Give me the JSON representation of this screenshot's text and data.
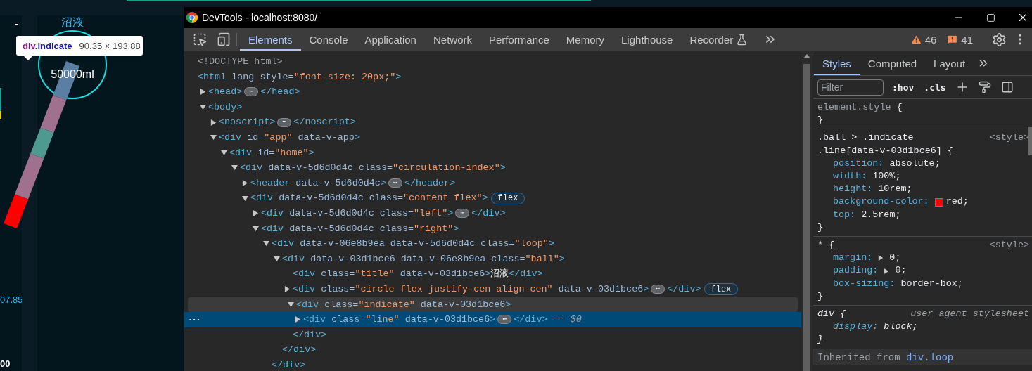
{
  "page": {
    "dash": "-",
    "axis_labels": [
      {
        "kind": "value",
        "text": "07.85"
      },
      {
        "kind": "total",
        "text": "00"
      }
    ],
    "ball": {
      "title": "沼液",
      "value": "50000ml"
    },
    "inspect_tooltip": {
      "tag": "div",
      "class_name": ".indicate",
      "size": "90.35 × 193.88"
    }
  },
  "devtools": {
    "window": {
      "title": "DevTools - localhost:8080/"
    },
    "tabs": [
      {
        "label": "Elements",
        "selected": true,
        "experimental": false
      },
      {
        "label": "Console",
        "selected": false,
        "experimental": false
      },
      {
        "label": "Application",
        "selected": false,
        "experimental": false
      },
      {
        "label": "Network",
        "selected": false,
        "experimental": false
      },
      {
        "label": "Performance",
        "selected": false,
        "experimental": false
      },
      {
        "label": "Memory",
        "selected": false,
        "experimental": false
      },
      {
        "label": "Lighthouse",
        "selected": false,
        "experimental": false
      },
      {
        "label": "Recorder",
        "selected": false,
        "experimental": true
      }
    ],
    "counters": {
      "warnings": "46",
      "issues": "41"
    },
    "tree": {
      "row_menu": "•••",
      "nodes": [
        {
          "selected": false,
          "hovered": false,
          "parts": [
            {
              "kind": "doctype",
              "text": "<!DOCTYPE html>"
            }
          ]
        },
        {
          "selected": false,
          "hovered": false,
          "parts": [
            {
              "kind": "tag",
              "text": "<html"
            },
            {
              "kind": "attr",
              "text": " lang style="
            },
            {
              "kind": "value",
              "text": "\"font-size: 20px;\""
            },
            {
              "kind": "tag",
              "text": ">"
            }
          ],
          "children": [
            {
              "selected": false,
              "hovered": false,
              "expanded": false,
              "parts": [
                {
                  "kind": "tag",
                  "text": "<head>"
                },
                {
                  "kind": "ellipsis",
                  "text": "⋯"
                },
                {
                  "kind": "tag",
                  "text": "</head>"
                }
              ]
            },
            {
              "selected": false,
              "hovered": false,
              "expanded": true,
              "parts": [
                {
                  "kind": "tag",
                  "text": "<body>"
                }
              ],
              "children": [
                {
                  "selected": false,
                  "hovered": false,
                  "expanded": false,
                  "parts": [
                    {
                      "kind": "tag",
                      "text": "<noscript>"
                    },
                    {
                      "kind": "ellipsis",
                      "text": "⋯"
                    },
                    {
                      "kind": "tag",
                      "text": "</noscript>"
                    }
                  ]
                },
                {
                  "selected": false,
                  "hovered": false,
                  "expanded": true,
                  "parts": [
                    {
                      "kind": "tag",
                      "text": "<div"
                    },
                    {
                      "kind": "attr",
                      "text": " id="
                    },
                    {
                      "kind": "value",
                      "text": "\"app\""
                    },
                    {
                      "kind": "attr",
                      "text": " data-v-app"
                    },
                    {
                      "kind": "tag",
                      "text": ">"
                    }
                  ],
                  "children": [
                    {
                      "selected": false,
                      "hovered": false,
                      "expanded": true,
                      "parts": [
                        {
                          "kind": "tag",
                          "text": "<div"
                        },
                        {
                          "kind": "attr",
                          "text": " id="
                        },
                        {
                          "kind": "value",
                          "text": "\"home\""
                        },
                        {
                          "kind": "tag",
                          "text": ">"
                        }
                      ],
                      "children": [
                        {
                          "selected": false,
                          "hovered": false,
                          "expanded": true,
                          "parts": [
                            {
                              "kind": "tag",
                              "text": "<div"
                            },
                            {
                              "kind": "attr",
                              "text": " data-v-5d6d0d4c class="
                            },
                            {
                              "kind": "value",
                              "text": "\"circulation-index\""
                            },
                            {
                              "kind": "tag",
                              "text": ">"
                            }
                          ],
                          "children": [
                            {
                              "selected": false,
                              "hovered": false,
                              "expanded": false,
                              "parts": [
                                {
                                  "kind": "tag",
                                  "text": "<header"
                                },
                                {
                                  "kind": "attr",
                                  "text": " data-v-5d6d0d4c"
                                },
                                {
                                  "kind": "tag",
                                  "text": ">"
                                },
                                {
                                  "kind": "ellipsis",
                                  "text": "⋯"
                                },
                                {
                                  "kind": "tag",
                                  "text": "</header>"
                                }
                              ]
                            },
                            {
                              "selected": false,
                              "hovered": false,
                              "expanded": true,
                              "parts": [
                                {
                                  "kind": "tag",
                                  "text": "<div"
                                },
                                {
                                  "kind": "attr",
                                  "text": " data-v-5d6d0d4c class="
                                },
                                {
                                  "kind": "value",
                                  "text": "\"content flex\""
                                },
                                {
                                  "kind": "tag",
                                  "text": ">"
                                },
                                {
                                  "kind": "badge",
                                  "text": "flex"
                                }
                              ],
                              "children": [
                                {
                                  "selected": false,
                                  "hovered": false,
                                  "expanded": false,
                                  "parts": [
                                    {
                                      "kind": "tag",
                                      "text": "<div"
                                    },
                                    {
                                      "kind": "attr",
                                      "text": " data-v-5d6d0d4c class="
                                    },
                                    {
                                      "kind": "value",
                                      "text": "\"left\""
                                    },
                                    {
                                      "kind": "tag",
                                      "text": ">"
                                    },
                                    {
                                      "kind": "ellipsis",
                                      "text": "⋯"
                                    },
                                    {
                                      "kind": "tag",
                                      "text": "</div>"
                                    }
                                  ]
                                },
                                {
                                  "selected": false,
                                  "hovered": false,
                                  "expanded": true,
                                  "parts": [
                                    {
                                      "kind": "tag",
                                      "text": "<div"
                                    },
                                    {
                                      "kind": "attr",
                                      "text": " data-v-5d6d0d4c class="
                                    },
                                    {
                                      "kind": "value",
                                      "text": "\"right\""
                                    },
                                    {
                                      "kind": "tag",
                                      "text": ">"
                                    }
                                  ],
                                  "children": [
                                    {
                                      "selected": false,
                                      "hovered": false,
                                      "expanded": true,
                                      "parts": [
                                        {
                                          "kind": "tag",
                                          "text": "<div"
                                        },
                                        {
                                          "kind": "attr",
                                          "text": " data-v-06e8b9ea data-v-5d6d0d4c class="
                                        },
                                        {
                                          "kind": "value",
                                          "text": "\"loop\""
                                        },
                                        {
                                          "kind": "tag",
                                          "text": ">"
                                        }
                                      ],
                                      "close": "</div>",
                                      "children": [
                                        {
                                          "selected": false,
                                          "hovered": false,
                                          "expanded": true,
                                          "parts": [
                                            {
                                              "kind": "tag",
                                              "text": "<div"
                                            },
                                            {
                                              "kind": "attr",
                                              "text": " data-v-03d1bce6 data-v-06e8b9ea class="
                                            },
                                            {
                                              "kind": "value",
                                              "text": "\"ball\""
                                            },
                                            {
                                              "kind": "tag",
                                              "text": ">"
                                            }
                                          ],
                                          "close": "</div>",
                                          "children": [
                                            {
                                              "selected": false,
                                              "hovered": false,
                                              "parts": [
                                                {
                                                  "kind": "tag",
                                                  "text": "<div"
                                                },
                                                {
                                                  "kind": "attr",
                                                  "text": " class="
                                                },
                                                {
                                                  "kind": "value",
                                                  "text": "\"title\""
                                                },
                                                {
                                                  "kind": "attr",
                                                  "text": " data-v-03d1bce6"
                                                },
                                                {
                                                  "kind": "tag",
                                                  "text": ">"
                                                },
                                                {
                                                  "kind": "text",
                                                  "text": "沼液"
                                                },
                                                {
                                                  "kind": "tag",
                                                  "text": "</div>"
                                                }
                                              ]
                                            },
                                            {
                                              "selected": false,
                                              "hovered": false,
                                              "expanded": false,
                                              "parts": [
                                                {
                                                  "kind": "tag",
                                                  "text": "<div"
                                                },
                                                {
                                                  "kind": "attr",
                                                  "text": " class="
                                                },
                                                {
                                                  "kind": "value",
                                                  "text": "\"circle flex justify-cen align-cen\""
                                                },
                                                {
                                                  "kind": "attr",
                                                  "text": " data-v-03d1bce6"
                                                },
                                                {
                                                  "kind": "tag",
                                                  "text": ">"
                                                },
                                                {
                                                  "kind": "ellipsis",
                                                  "text": "⋯"
                                                },
                                                {
                                                  "kind": "tag",
                                                  "text": "</div>"
                                                },
                                                {
                                                  "kind": "badge",
                                                  "text": "flex"
                                                }
                                              ]
                                            },
                                            {
                                              "selected": false,
                                              "hovered": true,
                                              "expanded": true,
                                              "parts": [
                                                {
                                                  "kind": "tag",
                                                  "text": "<div"
                                                },
                                                {
                                                  "kind": "attr",
                                                  "text": " class="
                                                },
                                                {
                                                  "kind": "value",
                                                  "text": "\"indicate\""
                                                },
                                                {
                                                  "kind": "attr",
                                                  "text": " data-v-03d1bce6"
                                                },
                                                {
                                                  "kind": "tag",
                                                  "text": ">"
                                                }
                                              ],
                                              "close": "</div>",
                                              "children": [
                                                {
                                                  "selected": true,
                                                  "hovered": false,
                                                  "expanded": false,
                                                  "parts": [
                                                    {
                                                      "kind": "tag",
                                                      "text": "<div"
                                                    },
                                                    {
                                                      "kind": "attr",
                                                      "text": " class="
                                                    },
                                                    {
                                                      "kind": "value",
                                                      "text": "\"line\""
                                                    },
                                                    {
                                                      "kind": "attr",
                                                      "text": " data-v-03d1bce6"
                                                    },
                                                    {
                                                      "kind": "tag",
                                                      "text": ">"
                                                    },
                                                    {
                                                      "kind": "ellipsis",
                                                      "text": "⋯"
                                                    },
                                                    {
                                                      "kind": "tag",
                                                      "text": "</div>"
                                                    },
                                                    {
                                                      "kind": "marker",
                                                      "text": " == $0"
                                                    }
                                                  ]
                                                }
                                              ]
                                            }
                                          ]
                                        }
                                      ]
                                    }
                                  ]
                                }
                              ]
                            }
                          ]
                        }
                      ]
                    }
                  ]
                }
              ]
            }
          ]
        }
      ]
    },
    "styles_pane": {
      "tabs": [
        {
          "label": "Styles",
          "selected": true
        },
        {
          "label": "Computed",
          "selected": false
        },
        {
          "label": "Layout",
          "selected": false
        }
      ],
      "filter": {
        "placeholder": "Filter"
      },
      "toggles": [
        ":hov",
        ".cls"
      ],
      "rules": [
        {
          "kind": "inline",
          "selector": [
            "element.style"
          ],
          "open": "{",
          "close": "}"
        },
        {
          "kind": "author",
          "selector": [
            ".ball > .indicate",
            ".line[data-v-03d1bce6]"
          ],
          "open": "{",
          "source": "<style>",
          "close": "}",
          "properties": [
            {
              "name": "position:",
              "value": "absolute;"
            },
            {
              "name": "width:",
              "value": "100%;"
            },
            {
              "name": "height:",
              "value": "10rem;"
            },
            {
              "name": "background-color:",
              "value": "red;",
              "color": "#ff0000"
            },
            {
              "name": "top:",
              "value": "2.5rem;"
            }
          ]
        },
        {
          "kind": "author",
          "selector": [
            "*"
          ],
          "open": "{",
          "source": "<style>",
          "close": "}",
          "properties": [
            {
              "name": "margin:",
              "value": "0;",
              "expandable": true
            },
            {
              "name": "padding:",
              "value": "0;",
              "expandable": true
            },
            {
              "name": "box-sizing:",
              "value": "border-box;"
            }
          ]
        },
        {
          "kind": "user_agent",
          "selector": [
            "div"
          ],
          "open": "{",
          "source": "user agent stylesheet",
          "close": "}",
          "properties": [
            {
              "name": "display:",
              "value": "block;"
            }
          ]
        }
      ],
      "inherited": {
        "label": "Inherited from ",
        "link": "div.loop"
      }
    }
  }
}
